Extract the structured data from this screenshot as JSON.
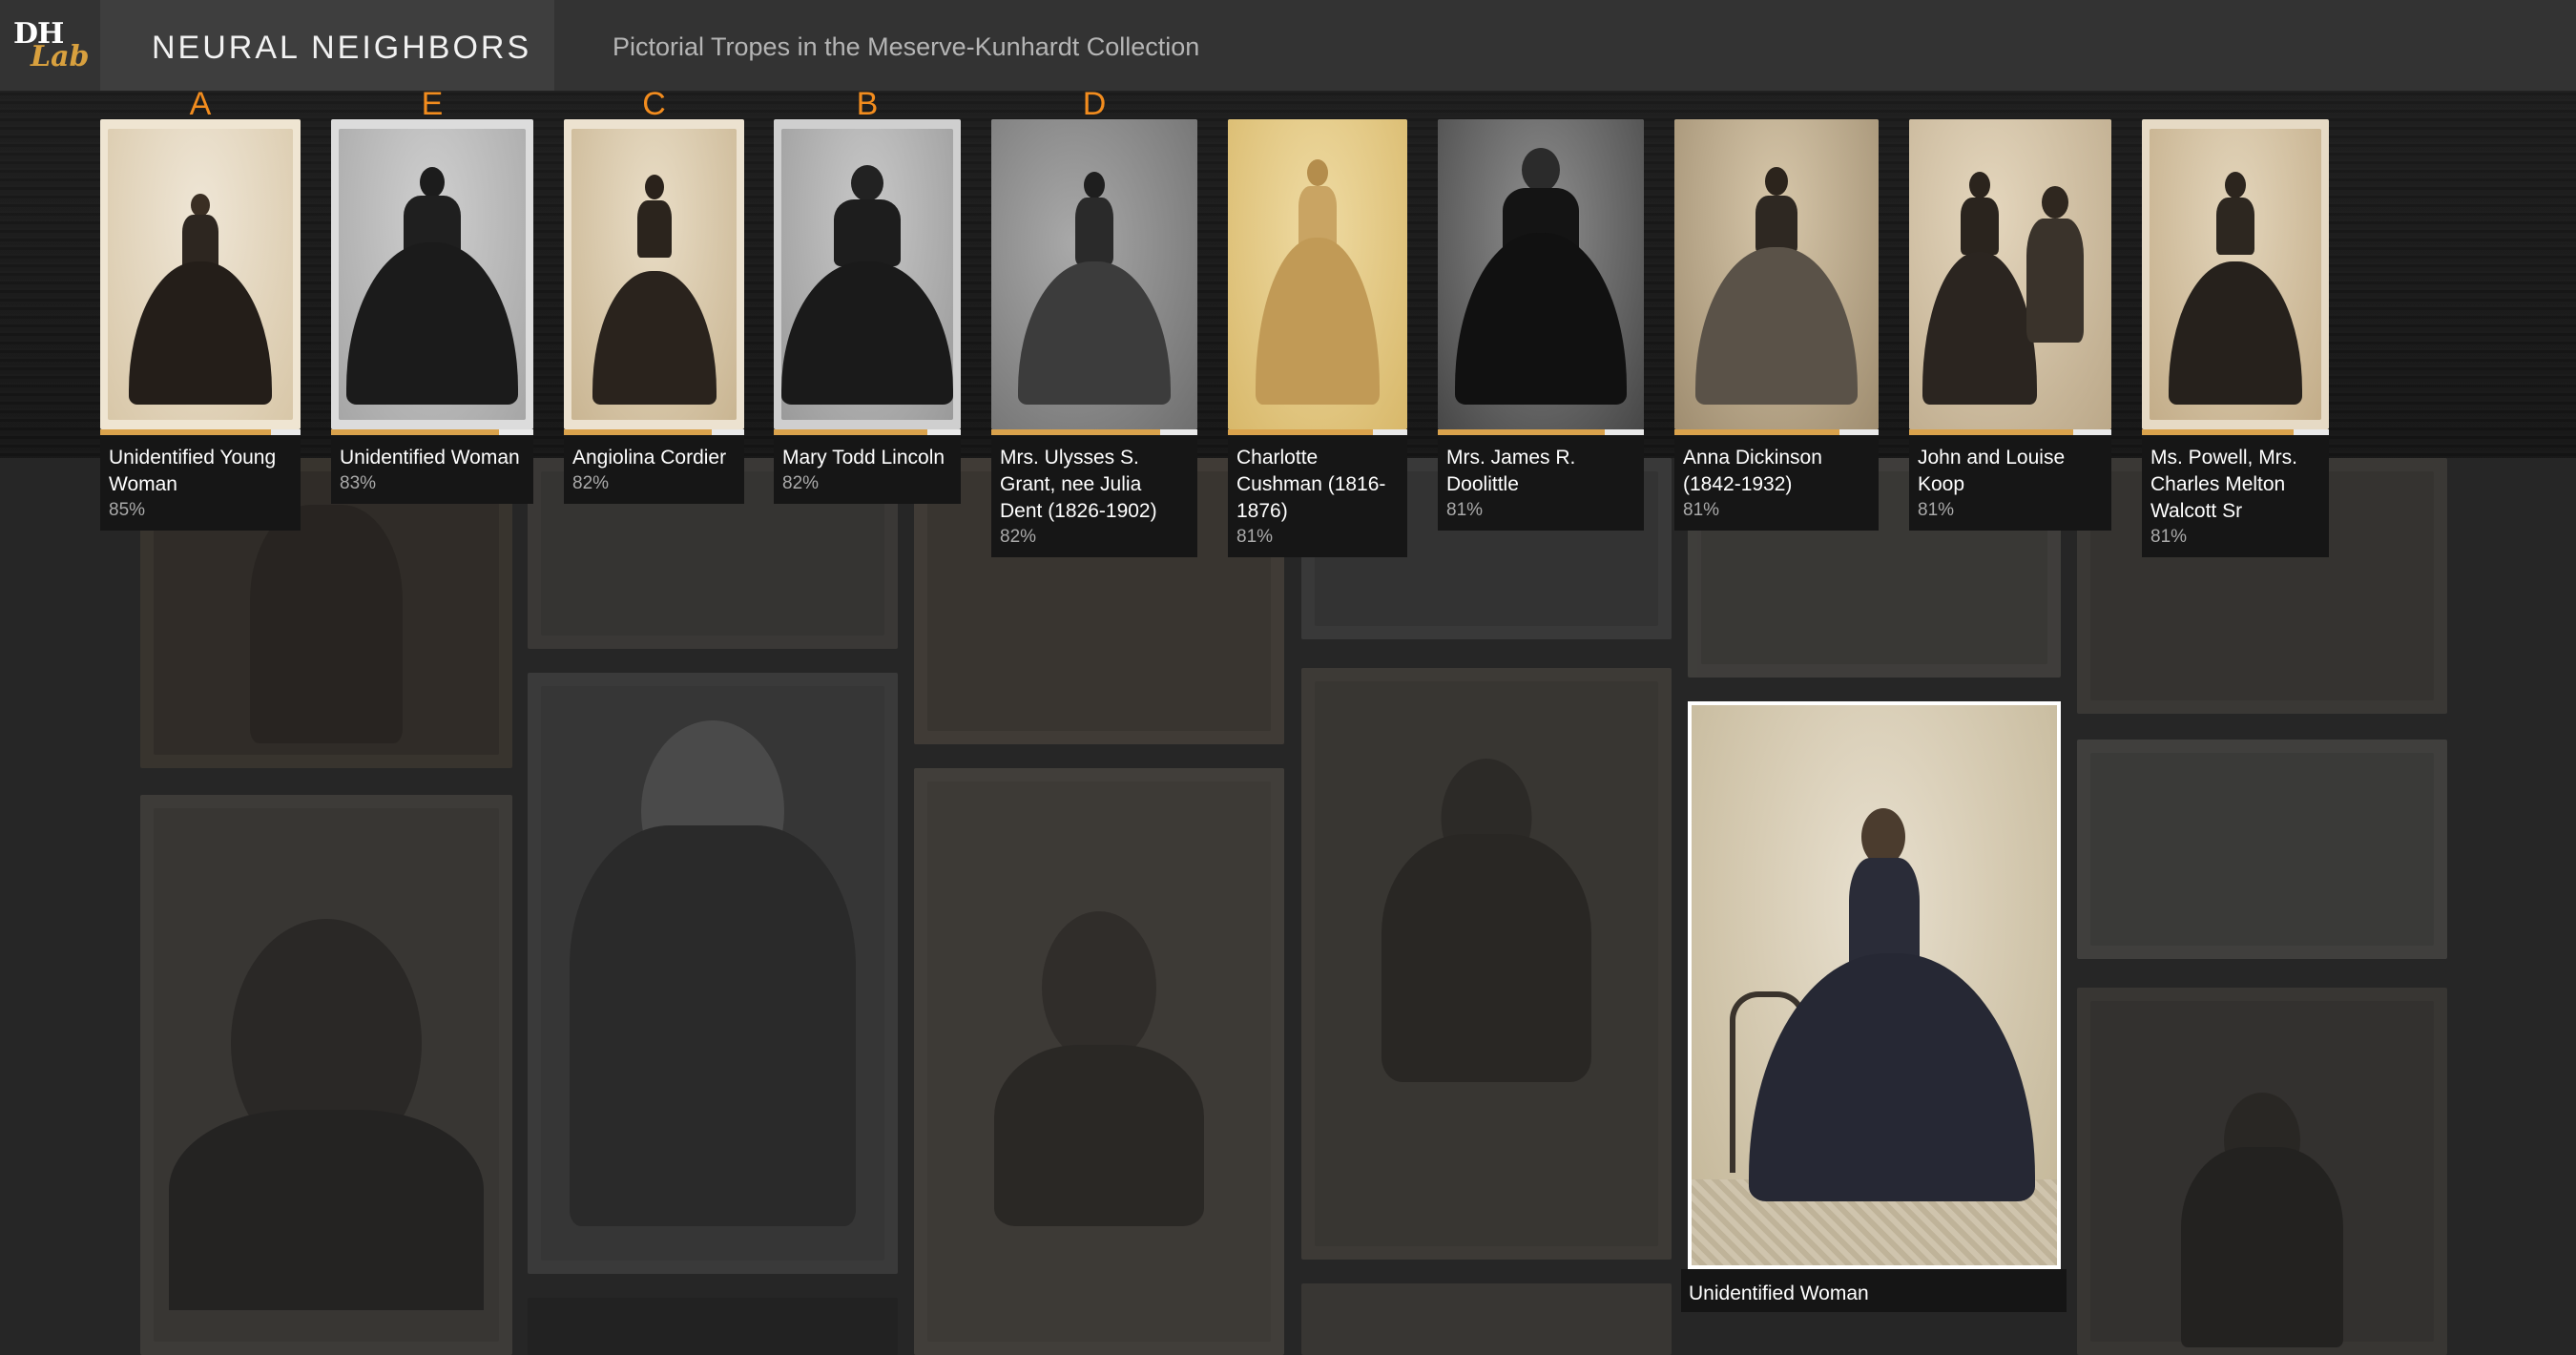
{
  "header": {
    "logo_primary": "DH",
    "logo_secondary": "Lab",
    "app_title": "NEURAL NEIGHBORS",
    "subtitle": "Pictorial Tropes in the Meserve-Kunhardt Collection"
  },
  "neighbors": [
    {
      "letter": "A",
      "name": "Unidentified Young Woman",
      "score": "85%",
      "similarity": 0.85,
      "tone": "sepia-light"
    },
    {
      "letter": "E",
      "name": "Unidentified Woman",
      "score": "83%",
      "similarity": 0.83,
      "tone": "grey"
    },
    {
      "letter": "C",
      "name": "Angiolina Cordier",
      "score": "82%",
      "similarity": 0.82,
      "tone": "sepia-light"
    },
    {
      "letter": "B",
      "name": "Mary Todd Lincoln",
      "score": "82%",
      "similarity": 0.82,
      "tone": "grey"
    },
    {
      "letter": "D",
      "name": "Mrs. Ulysses S. Grant, nee Julia Dent (1826-1902)",
      "score": "82%",
      "similarity": 0.82,
      "tone": "grey-dark"
    },
    {
      "letter": "",
      "name": "Charlotte Cushman (1816-1876)",
      "score": "81%",
      "similarity": 0.81,
      "tone": "gold"
    },
    {
      "letter": "",
      "name": "Mrs. James R. Doolittle",
      "score": "81%",
      "similarity": 0.81,
      "tone": "black"
    },
    {
      "letter": "",
      "name": "Anna Dickinson (1842-1932)",
      "score": "81%",
      "similarity": 0.81,
      "tone": "sepia"
    },
    {
      "letter": "",
      "name": "John and Louise Koop",
      "score": "81%",
      "similarity": 0.81,
      "tone": "sepia-light"
    },
    {
      "letter": "",
      "name": "Ms. Powell, Mrs. Charles Melton Walcott Sr",
      "score": "81%",
      "similarity": 0.81,
      "tone": "sepia-light"
    }
  ],
  "selected": {
    "caption": "Unidentified Woman"
  },
  "colors": {
    "accent_letter": "#f28c1e",
    "score_fill": "#d9a24c",
    "logo_lab": "#d8a03e"
  }
}
